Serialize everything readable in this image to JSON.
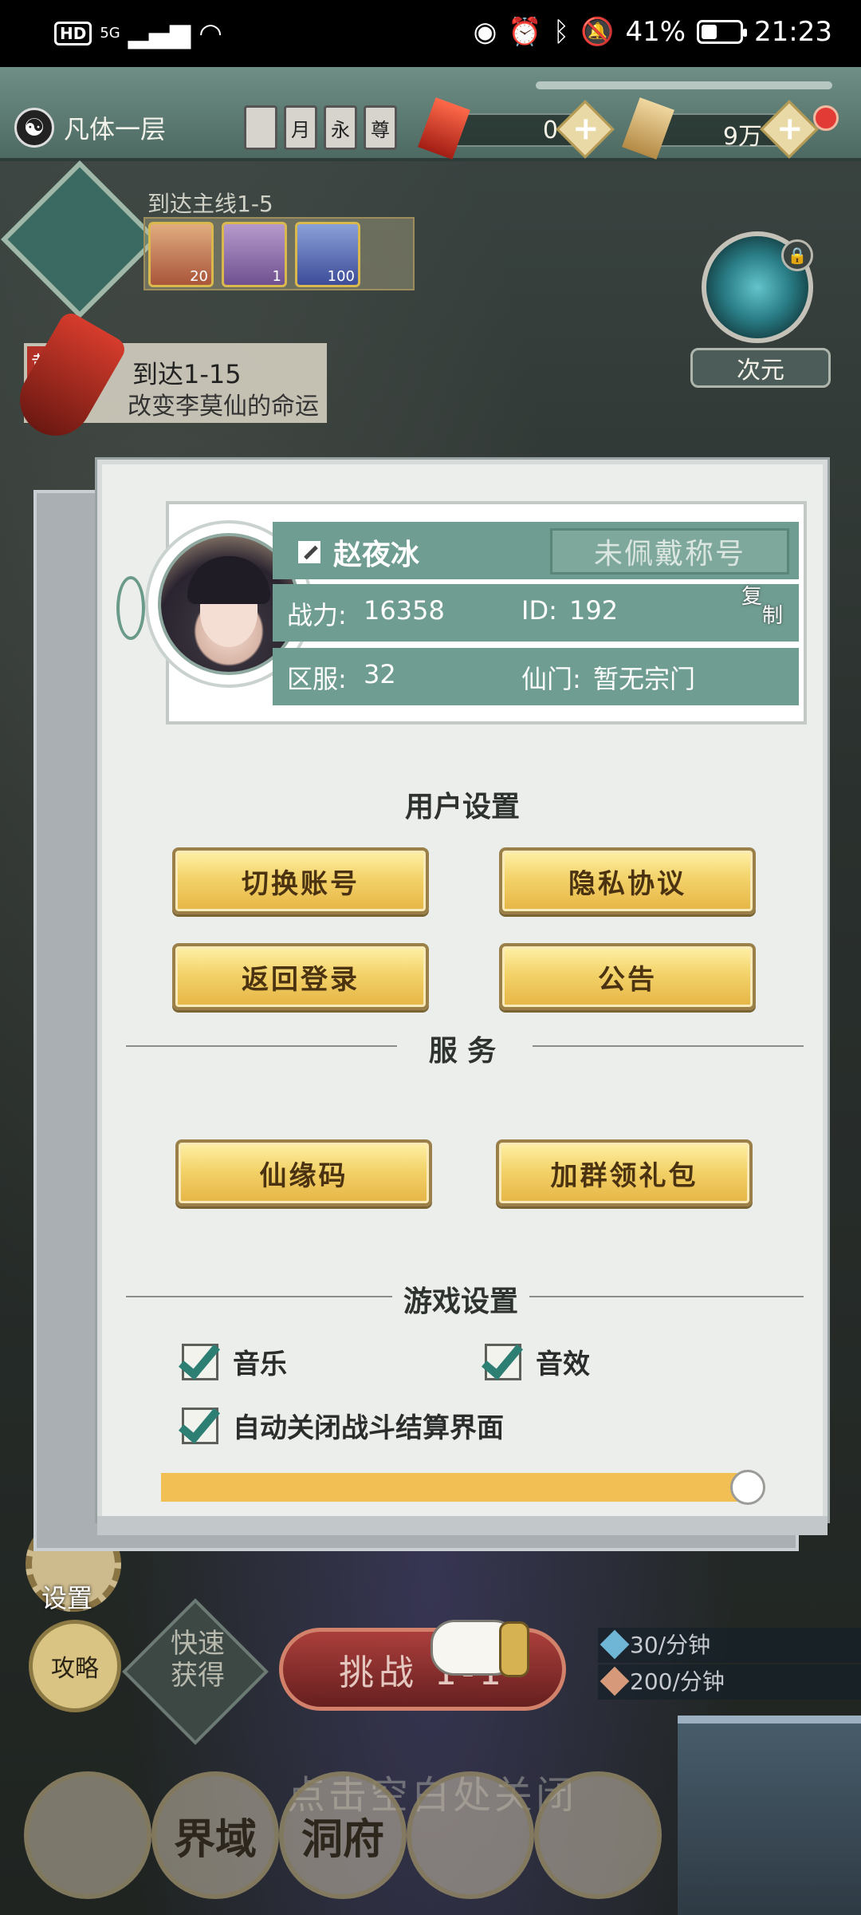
{
  "status_bar": {
    "hd": "HD",
    "network": "5G",
    "battery": "41%",
    "battery_level": 0.41,
    "time": "21:23"
  },
  "hud": {
    "realm": "凡体一层",
    "badges": [
      "",
      "月",
      "永",
      "尊"
    ],
    "resource1_value": "0",
    "resource2_value": "9万"
  },
  "game": {
    "quest_title": "到达主线1-5",
    "quest_item_counts": [
      "20",
      "1",
      "100"
    ],
    "huang_tag": "黄",
    "huang_line1": "到达1-15",
    "huang_line2": "改变李莫仙的命运",
    "portal_label": "次元",
    "settings_label": "设置",
    "guide_label": "攻略",
    "quick_label_1": "快速",
    "quick_label_2": "获得",
    "challenge_label": "挑战 1-1",
    "rate1": "30/分钟",
    "rate2": "200/分钟",
    "close_hint": "点击空白处关闭",
    "nav": [
      "",
      "界域",
      "洞府",
      "",
      ""
    ]
  },
  "profile": {
    "name": "赵夜冰",
    "title_button": "未佩戴称号",
    "power_label": "战力:",
    "power_value": "16358",
    "id_label": "ID:",
    "id_value": "192",
    "copy_label_1": "复",
    "copy_label_2": "制",
    "server_label": "区服:",
    "server_value": "32",
    "sect_label": "仙门:",
    "sect_value": "暂无宗门"
  },
  "user_settings": {
    "title": "用户设置",
    "switch_account": "切换账号",
    "privacy": "隐私协议",
    "back_login": "返回登录",
    "notice": "公告"
  },
  "service": {
    "title": "服 务",
    "code": "仙缘码",
    "join_group": "加群领礼包"
  },
  "game_settings": {
    "title": "游戏设置",
    "music": "音乐",
    "music_checked": true,
    "sfx": "音效",
    "sfx_checked": true,
    "auto_close": "自动关闭战斗结算界面",
    "auto_close_checked": true,
    "volume": 1.0
  }
}
